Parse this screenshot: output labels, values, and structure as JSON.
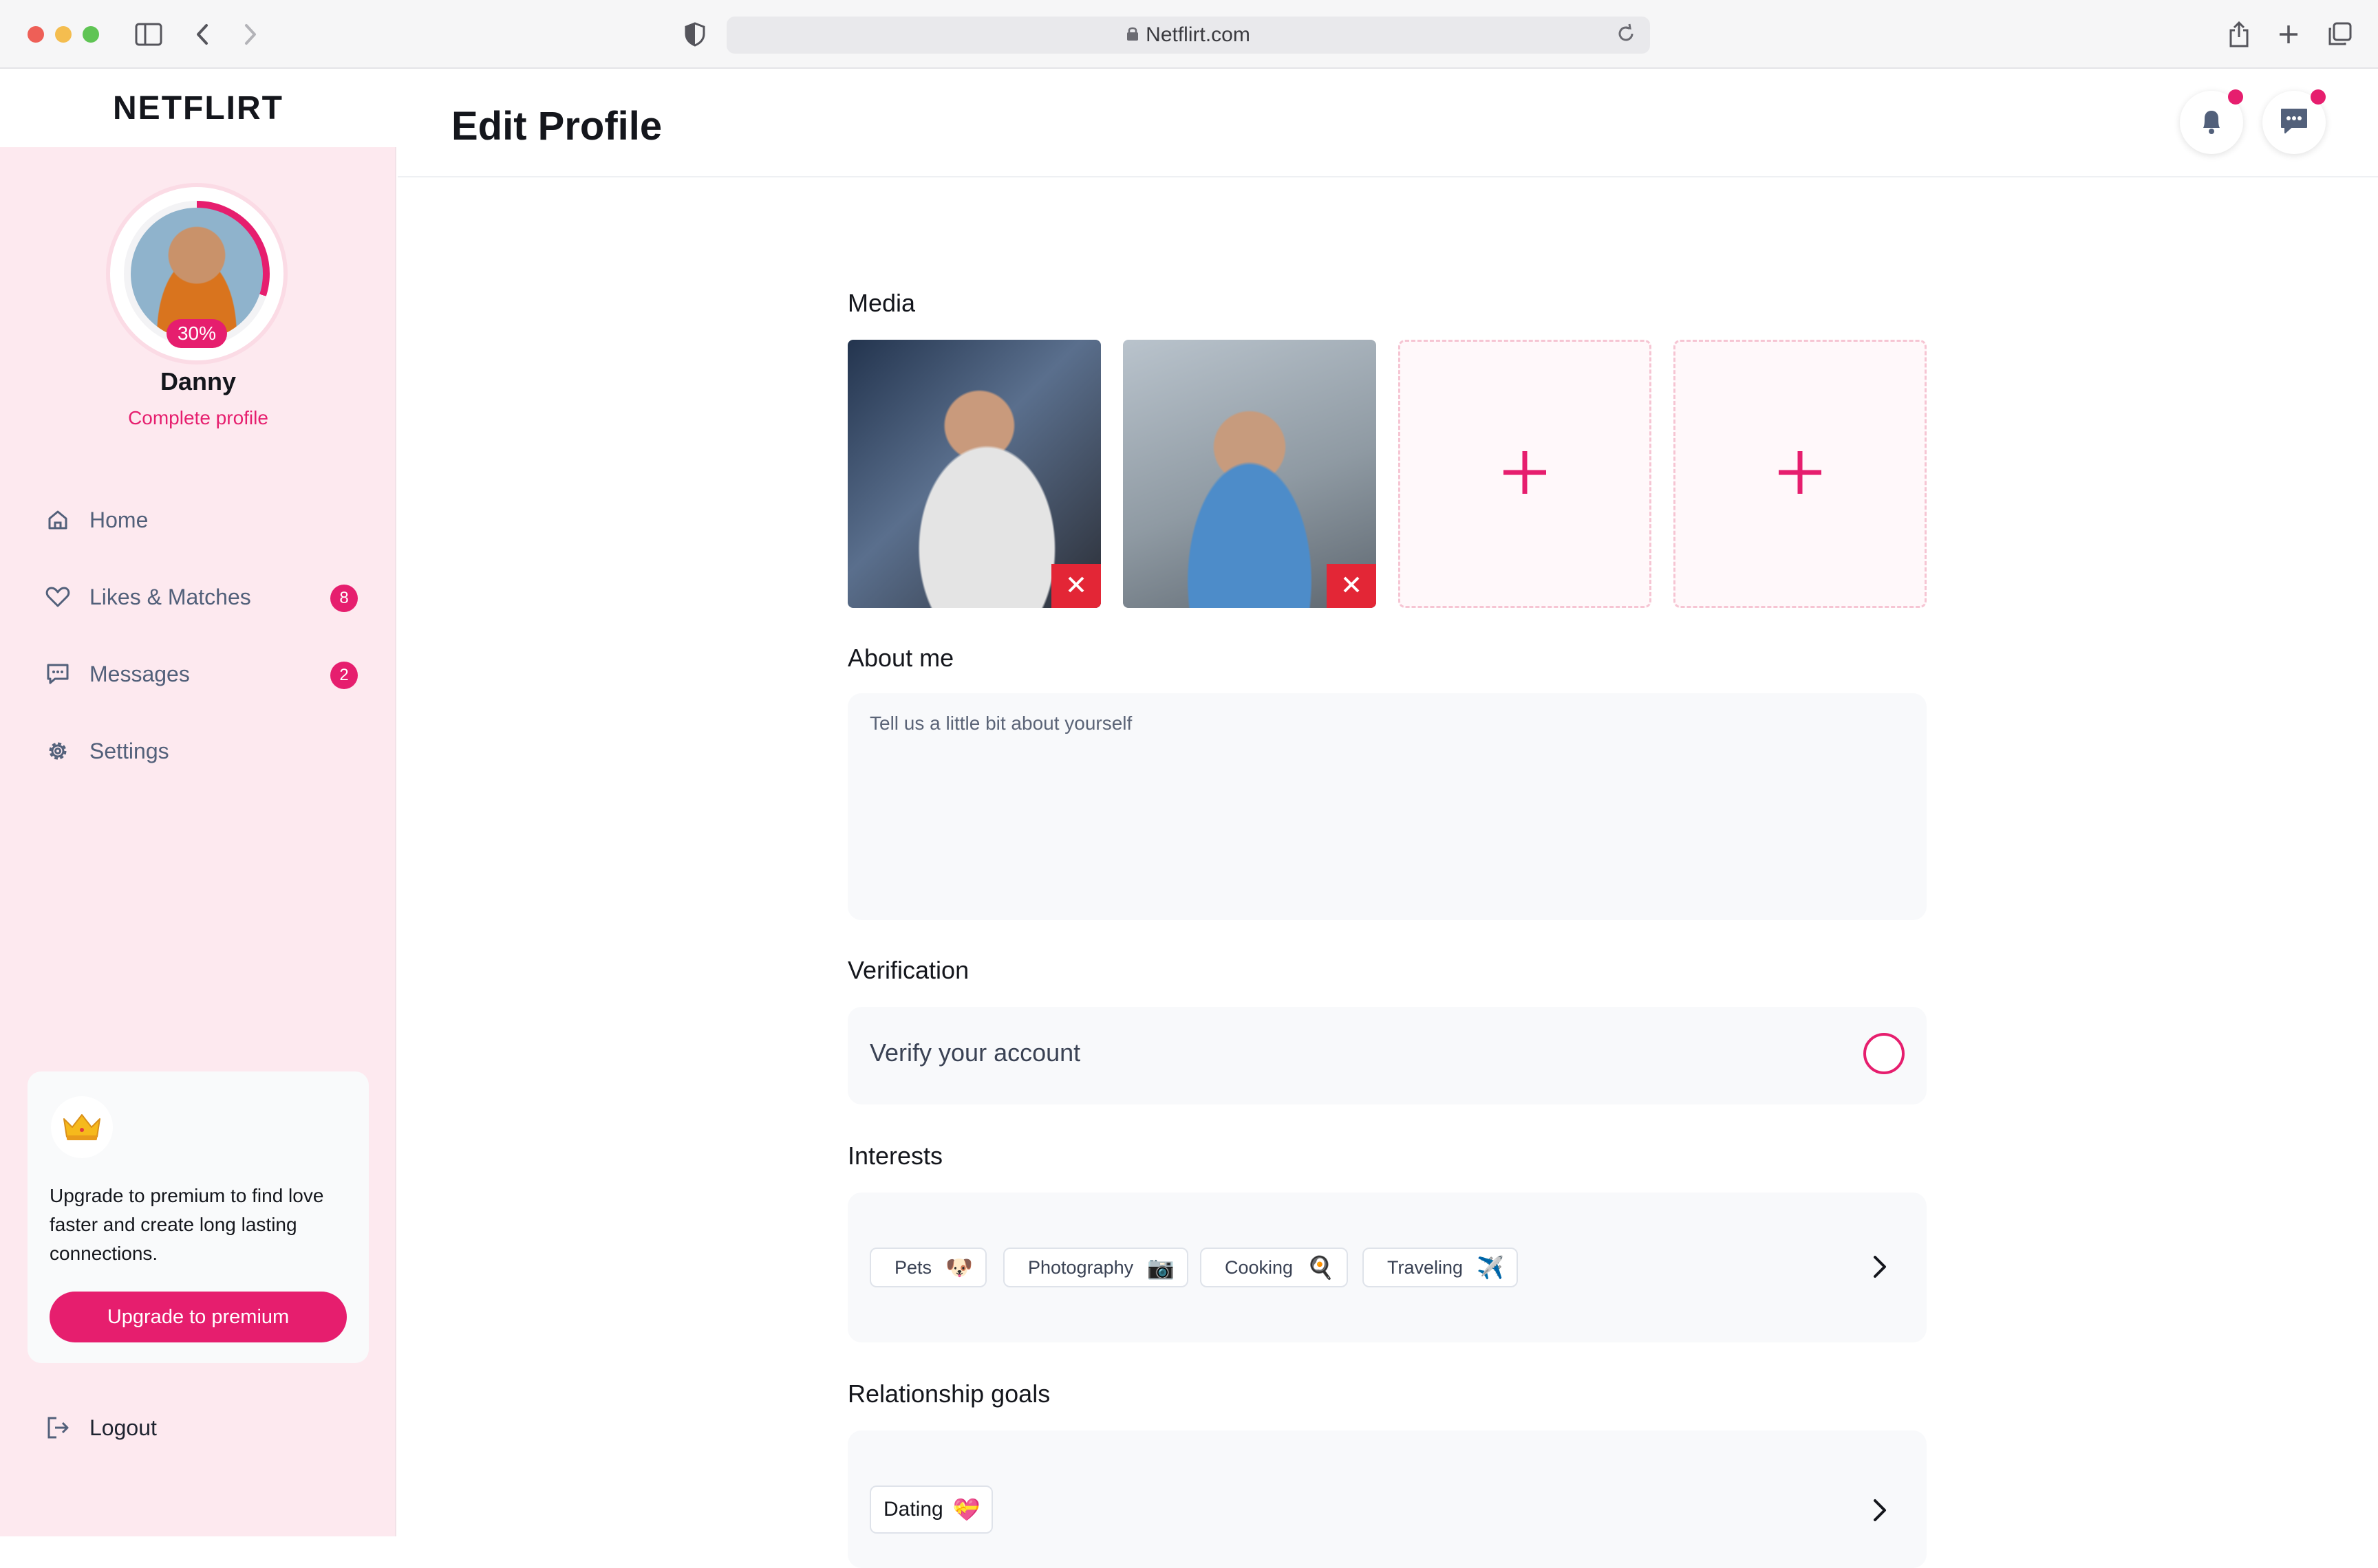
{
  "browser": {
    "url": "Netflirt.com"
  },
  "sidebar": {
    "brand": "NETFLIRT",
    "profile": {
      "name": "Danny",
      "completion": "30%",
      "complete_link": "Complete profile"
    },
    "nav": [
      {
        "label": "Home",
        "icon": "home-icon"
      },
      {
        "label": "Likes & Matches",
        "icon": "heart-icon",
        "badge": "8"
      },
      {
        "label": "Messages",
        "icon": "message-icon",
        "badge": "2"
      },
      {
        "label": "Settings",
        "icon": "gear-icon"
      }
    ],
    "premium": {
      "icon": "crown-icon",
      "text": "Upgrade to premium to find love faster and create long lasting connections.",
      "button": "Upgrade to premium"
    },
    "logout": "Logout"
  },
  "header": {
    "title": "Edit Profile",
    "notifications_icon": "bell-icon",
    "messages_icon": "chat-icon"
  },
  "media": {
    "label": "Media",
    "photos": 2,
    "empty_slots": 2
  },
  "about": {
    "label": "About me",
    "placeholder": "Tell us a little bit about yourself",
    "value": ""
  },
  "verification": {
    "label": "Verification",
    "text": "Verify your account"
  },
  "interests": {
    "label": "Interests",
    "chips": [
      {
        "label": "Pets",
        "emoji": "🐶"
      },
      {
        "label": "Photography",
        "emoji": "📷"
      },
      {
        "label": "Cooking",
        "emoji": "🍳"
      },
      {
        "label": "Traveling",
        "emoji": "✈️"
      }
    ]
  },
  "relationship": {
    "label": "Relationship goals",
    "chips": [
      {
        "label": "Dating",
        "emoji": "💝"
      }
    ]
  },
  "colors": {
    "accent": "#e61e6e",
    "sidebar_bg": "#fde9ef",
    "delete": "#e32636"
  }
}
